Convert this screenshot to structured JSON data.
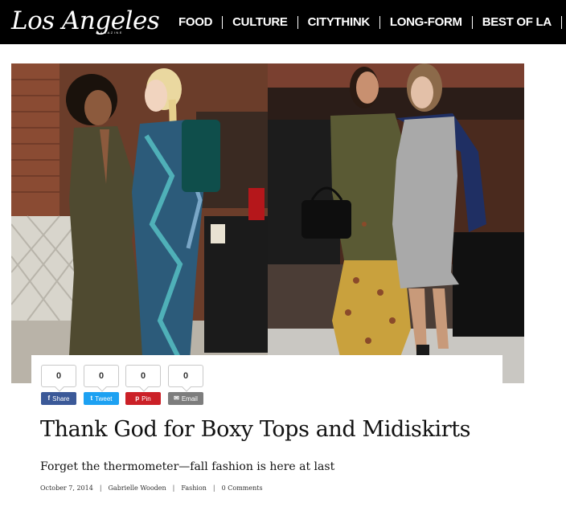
{
  "brand": {
    "logo_text": "Los Angeles",
    "logo_sub": "MAGAZINE"
  },
  "nav": {
    "items": [
      {
        "label": "FOOD"
      },
      {
        "label": "CULTURE"
      },
      {
        "label": "CITYTHINK"
      },
      {
        "label": "LONG-FORM"
      },
      {
        "label": "BEST OF LA"
      }
    ]
  },
  "share": {
    "buttons": [
      {
        "label": "Share",
        "count": "0",
        "icon": "facebook-icon",
        "color": "#3b5998",
        "glyph": "f"
      },
      {
        "label": "Tweet",
        "count": "0",
        "icon": "twitter-icon",
        "color": "#1da1f2",
        "glyph": "t"
      },
      {
        "label": "Pin",
        "count": "0",
        "icon": "pinterest-icon",
        "color": "#cb2027",
        "glyph": "p"
      },
      {
        "label": "Email",
        "count": "0",
        "icon": "email-icon",
        "color": "#7d7d7d",
        "glyph": "✉"
      }
    ]
  },
  "article": {
    "title": "Thank God for Boxy Tops and Midiskirts",
    "subtitle": "Forget the thermometer—fall fashion is here at last",
    "date": "October 7, 2014",
    "author": "Gabrielle Wooden",
    "category": "Fashion",
    "comments": "0 Comments"
  }
}
